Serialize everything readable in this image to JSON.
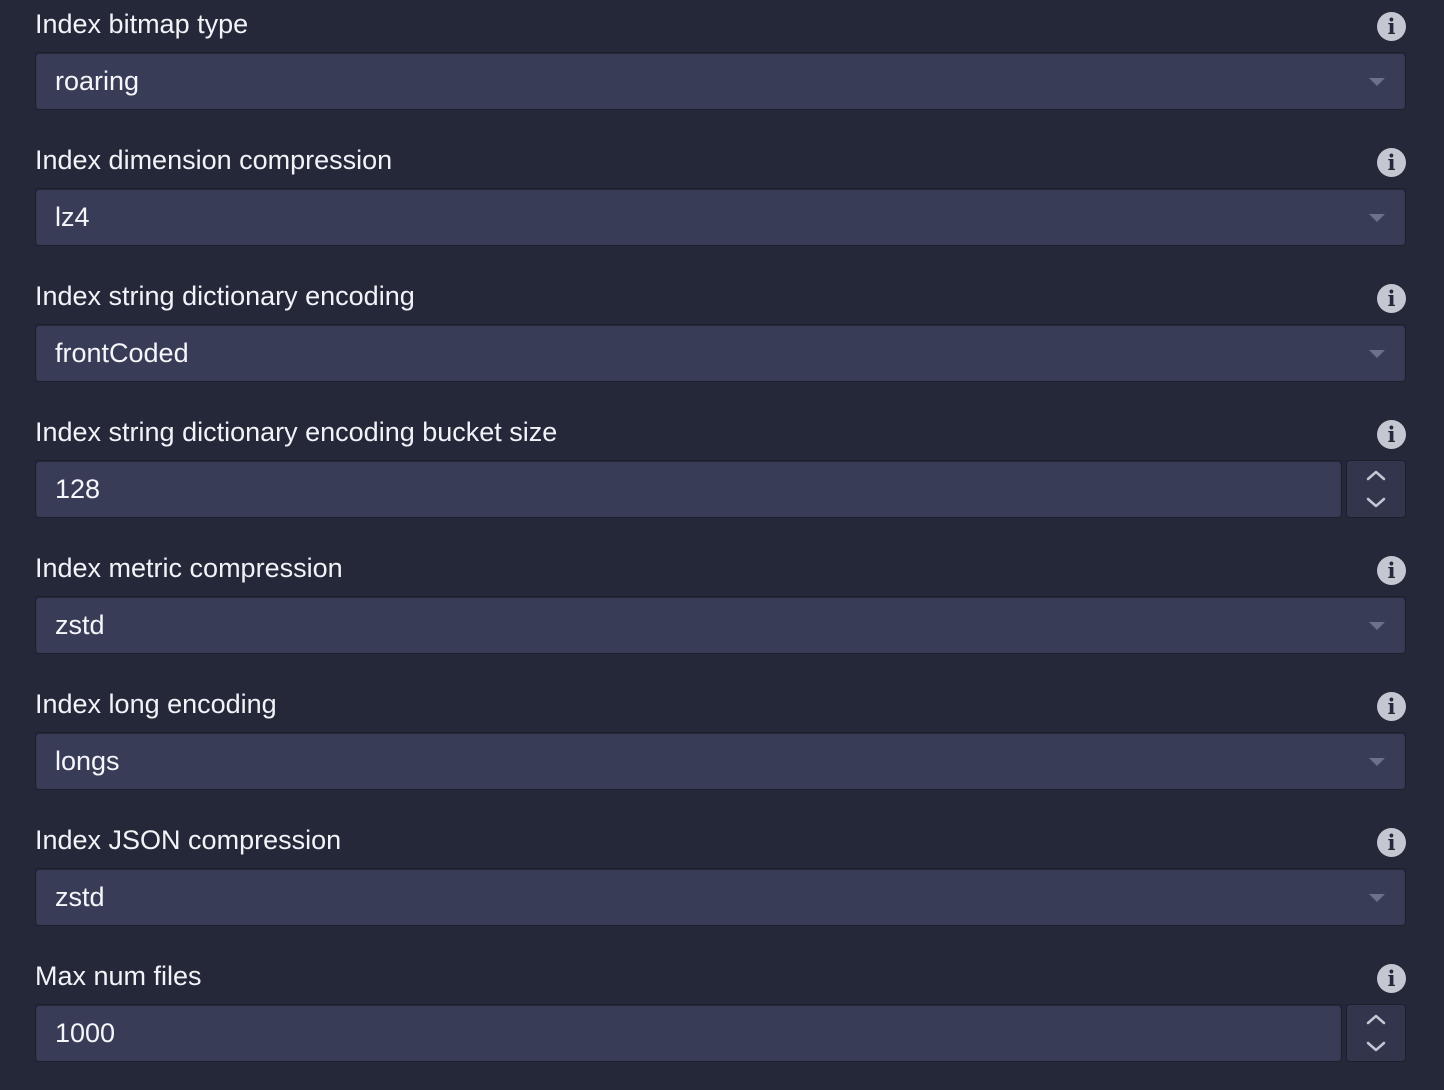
{
  "fields": [
    {
      "label": "Index bitmap type",
      "value": "roaring",
      "kind": "select"
    },
    {
      "label": "Index dimension compression",
      "value": "lz4",
      "kind": "select"
    },
    {
      "label": "Index string dictionary encoding",
      "value": "frontCoded",
      "kind": "select"
    },
    {
      "label": "Index string dictionary encoding bucket size",
      "value": "128",
      "kind": "numeric"
    },
    {
      "label": "Index metric compression",
      "value": "zstd",
      "kind": "select"
    },
    {
      "label": "Index long encoding",
      "value": "longs",
      "kind": "select"
    },
    {
      "label": "Index JSON compression",
      "value": "zstd",
      "kind": "select"
    },
    {
      "label": "Max num files",
      "value": "1000",
      "kind": "numeric"
    }
  ],
  "info_glyph": "i",
  "icons": {
    "info": "info-icon",
    "select_caret": "caret-down-icon",
    "increment": "chevron-up-icon",
    "decrement": "chevron-down-icon"
  },
  "colors": {
    "background": "#252839",
    "control_fill": "#383c57",
    "text": "#f2f3f8",
    "info_icon": "#c4c7d2"
  }
}
